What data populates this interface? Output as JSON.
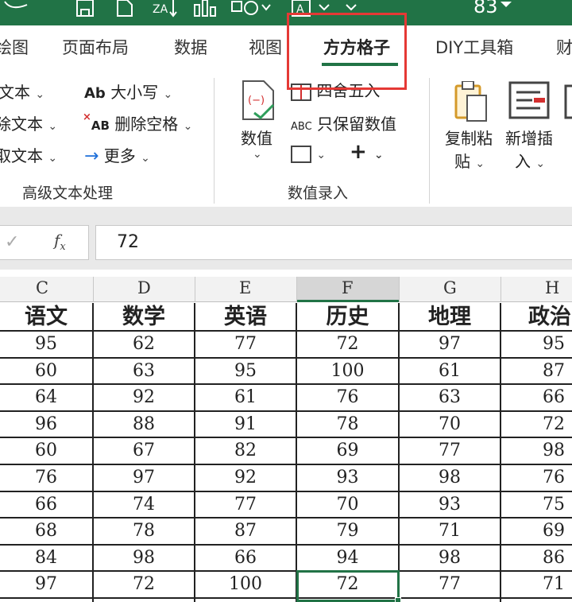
{
  "colors": {
    "ribbon_green": "#217346",
    "highlight_red": "#e53935",
    "grid_line": "#222222",
    "header_bg": "#f2f2f2"
  },
  "titlebar": {
    "user_initials": "83",
    "icons": [
      "undo-icon",
      "save-icon",
      "new-file-icon",
      "sort-az-icon",
      "chart-icon",
      "shapes-icon",
      "text-box-icon",
      "dropdown-icon"
    ]
  },
  "tabs": [
    {
      "label": "绘图"
    },
    {
      "label": "页面布局"
    },
    {
      "label": "数据"
    },
    {
      "label": "视图"
    },
    {
      "label": "方方格子"
    },
    {
      "label": "DIY工具箱"
    },
    {
      "label": "财"
    }
  ],
  "ribbon": {
    "text_group": {
      "items": [
        {
          "label": "文本"
        },
        {
          "label": "除文本"
        },
        {
          "label": "取文本"
        }
      ],
      "case_label": "大小写",
      "case_icon_text": "Ab",
      "delete_spaces_label": "删除空格",
      "delete_spaces_icon_text": "AB",
      "more_label": "更多",
      "group_label": "高级文本处理"
    },
    "number_group": {
      "value_label": "数值",
      "round_label": "四舍五入",
      "keep_values_label": "只保留数值",
      "keep_values_icon_text": "ABC",
      "group_label": "数值录入"
    },
    "copy_group": {
      "copy_paste_label_1": "复制粘",
      "copy_paste_label_2": "贴",
      "insert_label_1": "新增插",
      "insert_label_2": "入"
    }
  },
  "formula_bar": {
    "value": "72"
  },
  "columns": [
    "C",
    "D",
    "E",
    "F",
    "G",
    "H"
  ],
  "headers": [
    "语文",
    "数学",
    "英语",
    "历史",
    "地理",
    "政治"
  ],
  "rows": [
    [
      "95",
      "62",
      "77",
      "72",
      "97",
      "95"
    ],
    [
      "60",
      "63",
      "95",
      "100",
      "61",
      "87"
    ],
    [
      "64",
      "92",
      "61",
      "76",
      "63",
      "66"
    ],
    [
      "96",
      "88",
      "91",
      "78",
      "70",
      "72"
    ],
    [
      "60",
      "67",
      "82",
      "69",
      "77",
      "98"
    ],
    [
      "76",
      "97",
      "92",
      "93",
      "98",
      "76"
    ],
    [
      "66",
      "74",
      "77",
      "70",
      "93",
      "75"
    ],
    [
      "68",
      "78",
      "87",
      "79",
      "71",
      "69"
    ],
    [
      "84",
      "98",
      "66",
      "94",
      "98",
      "86"
    ],
    [
      "97",
      "72",
      "100",
      "72",
      "77",
      "71"
    ]
  ]
}
